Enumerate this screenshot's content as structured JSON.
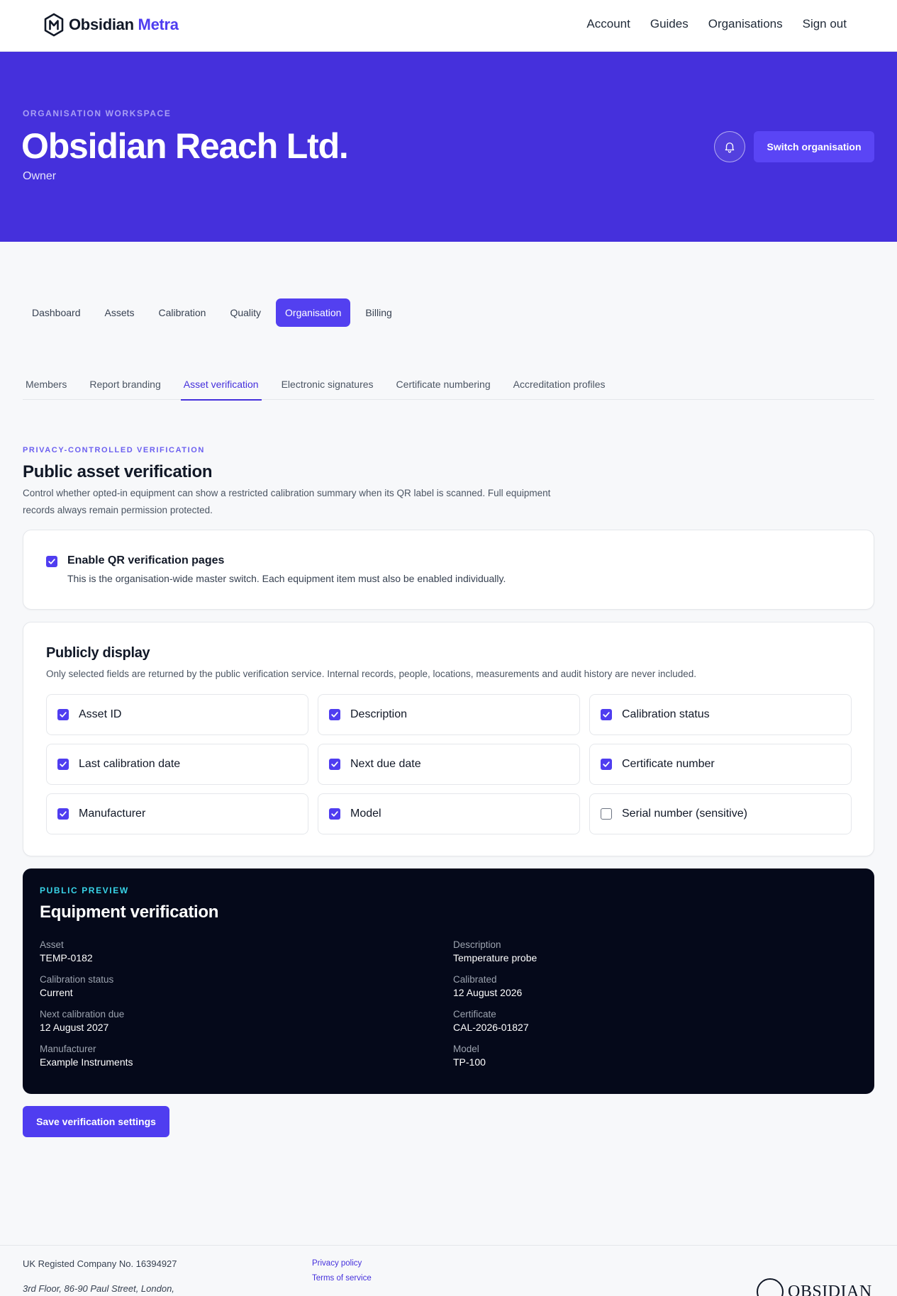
{
  "brand": {
    "name": "Obsidian",
    "accent": "Metra"
  },
  "nav": {
    "links": [
      "Account",
      "Guides",
      "Organisations",
      "Sign out"
    ]
  },
  "hero": {
    "kicker": "ORGANISATION WORKSPACE",
    "title": "Obsidian Reach Ltd.",
    "role": "Owner",
    "switch_label": "Switch organisation"
  },
  "primary_tabs": [
    "Dashboard",
    "Assets",
    "Calibration",
    "Quality",
    "Organisation",
    "Billing"
  ],
  "sub_tabs": [
    "Members",
    "Report branding",
    "Asset verification",
    "Electronic signatures",
    "Certificate numbering",
    "Accreditation profiles"
  ],
  "section": {
    "kicker": "PRIVACY-CONTROLLED VERIFICATION",
    "title": "Public asset verification",
    "description": "Control whether opted-in equipment can show a restricted calibration summary when its QR label is scanned. Full equipment records always remain permission protected."
  },
  "qr": {
    "checked": true,
    "title": "Enable QR verification pages",
    "description": "This is the organisation-wide master switch. Each equipment item must also be enabled individually."
  },
  "display": {
    "title": "Publicly display",
    "description": "Only selected fields are returned by the public verification service. Internal records, people, locations, measurements and audit history are never included.",
    "fields": [
      {
        "label": "Asset ID",
        "checked": true
      },
      {
        "label": "Description",
        "checked": true
      },
      {
        "label": "Calibration status",
        "checked": true
      },
      {
        "label": "Last calibration date",
        "checked": true
      },
      {
        "label": "Next due date",
        "checked": true
      },
      {
        "label": "Certificate number",
        "checked": true
      },
      {
        "label": "Manufacturer",
        "checked": true
      },
      {
        "label": "Model",
        "checked": true
      },
      {
        "label": "Serial number (sensitive)",
        "checked": false
      }
    ]
  },
  "preview": {
    "kicker": "PUBLIC PREVIEW",
    "title": "Equipment verification",
    "items": [
      {
        "label": "Asset",
        "value": "TEMP-0182"
      },
      {
        "label": "Description",
        "value": "Temperature probe"
      },
      {
        "label": "Calibration status",
        "value": "Current"
      },
      {
        "label": "Calibrated",
        "value": "12 August 2026"
      },
      {
        "label": "Next calibration due",
        "value": "12 August 2027"
      },
      {
        "label": "Certificate",
        "value": "CAL-2026-01827"
      },
      {
        "label": "Manufacturer",
        "value": "Example Instruments"
      },
      {
        "label": "Model",
        "value": "TP-100"
      }
    ]
  },
  "save_label": "Save verification settings",
  "footer": {
    "company": "UK Registed Company No. 16394927",
    "address": "3rd Floor, 86-90 Paul Street, London,",
    "links": [
      "Privacy policy",
      "Terms of service"
    ],
    "logo_text": "OBSIDIAN"
  },
  "colors": {
    "brand_accent": "#4f3df0",
    "hero_bg": "#4530dc",
    "preview_bg": "#05091a",
    "preview_kicker": "#38d4e8"
  }
}
